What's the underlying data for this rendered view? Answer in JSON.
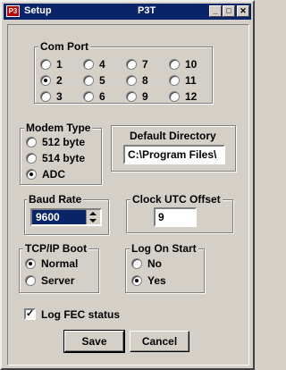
{
  "window": {
    "app_icon_text": "P3",
    "title": "Setup",
    "title_center": "P3T",
    "minimize_glyph": "_",
    "maximize_glyph": "□",
    "close_glyph": "✕"
  },
  "com_port": {
    "label": "Com Port",
    "selected": "2",
    "options": [
      "1",
      "2",
      "3",
      "4",
      "5",
      "6",
      "7",
      "8",
      "9",
      "10",
      "11",
      "12"
    ]
  },
  "modem_type": {
    "label": "Modem Type",
    "selected": "ADC",
    "options": [
      "512 byte",
      "514 byte",
      "ADC"
    ]
  },
  "default_directory": {
    "label": "Default Directory",
    "value": "C:\\Program Files\\"
  },
  "baud_rate": {
    "label": "Baud Rate",
    "value": "9600"
  },
  "clock_utc_offset": {
    "label": "Clock UTC Offset",
    "value": "9"
  },
  "tcpip_boot": {
    "label": "TCP/IP Boot",
    "selected": "Normal",
    "options": [
      "Normal",
      "Server"
    ]
  },
  "log_on_start": {
    "label": "Log On Start",
    "selected": "Yes",
    "options": [
      "No",
      "Yes"
    ]
  },
  "log_fec": {
    "label": "Log FEC status",
    "checked": true,
    "check_glyph": "✓"
  },
  "buttons": {
    "save": "Save",
    "cancel": "Cancel"
  }
}
